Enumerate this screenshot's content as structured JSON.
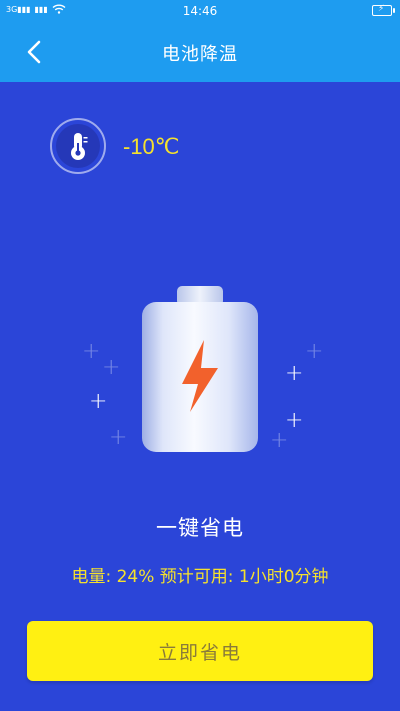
{
  "status_bar": {
    "time": "14:46",
    "signal_text": "3G"
  },
  "header": {
    "title": "电池降温",
    "back_icon": "chevron-left-icon"
  },
  "temperature": {
    "value": "-10℃",
    "icon": "thermometer-icon"
  },
  "main": {
    "action_title": "一键省电",
    "power_info": "电量: 24% 预计可用: 1小时0分钟",
    "save_button_label": "立即省电"
  },
  "colors": {
    "header_bg": "#1e9cf0",
    "page_bg": "#2b45d8",
    "accent_yellow": "#f5e12d",
    "button_bg": "#fff012",
    "bolt_orange": "#f2612c"
  }
}
